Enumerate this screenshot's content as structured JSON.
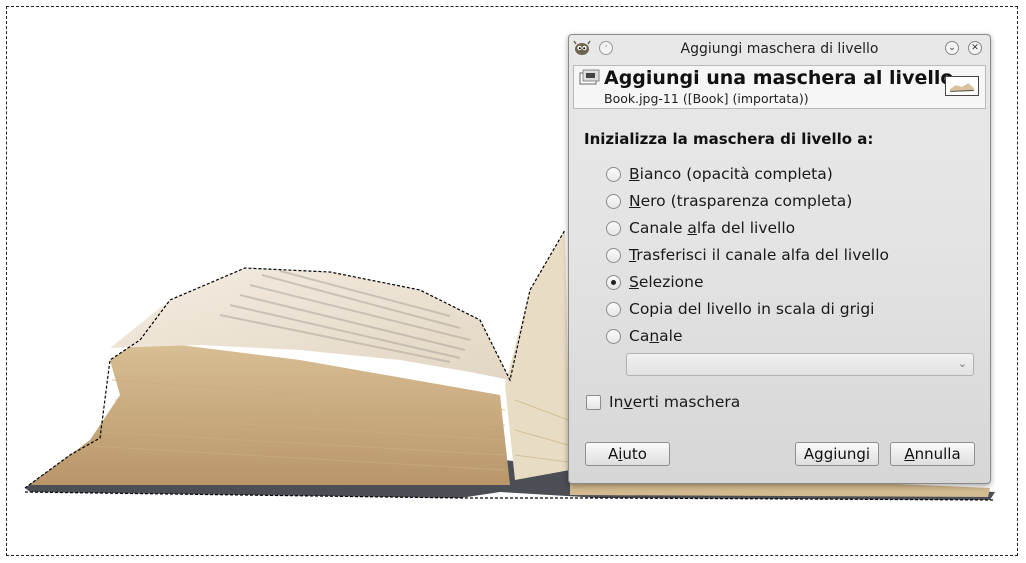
{
  "dialog": {
    "window_title": "Aggiungi maschera di livello",
    "menu_glyph": "·",
    "minimize_glyph": "⌄",
    "close_glyph": "✕",
    "header_title": "Aggiungi una maschera al livello",
    "header_subtitle": "Book.jpg-11 ([Book] (importata))",
    "section_label": "Inizializza la maschera di livello a:",
    "options": [
      {
        "pre": "",
        "u": "B",
        "post": "ianco (opacità completa)",
        "checked": false
      },
      {
        "pre": "",
        "u": "N",
        "post": "ero (trasparenza completa)",
        "checked": false
      },
      {
        "pre": "Canale ",
        "u": "a",
        "post": "lfa del livello",
        "checked": false
      },
      {
        "pre": "",
        "u": "T",
        "post": "rasferisci il canale alfa del livello",
        "checked": false
      },
      {
        "pre": "",
        "u": "S",
        "post": "elezione",
        "checked": true
      },
      {
        "pre": "Copia del livello in scala di ",
        "u": "g",
        "post": "rigi",
        "checked": false
      },
      {
        "pre": "Ca",
        "u": "n",
        "post": "ale",
        "checked": false
      }
    ],
    "channel_combo_value": "",
    "invert": {
      "pre": "In",
      "u": "v",
      "post": "erti maschera",
      "checked": false
    },
    "buttons": {
      "help": {
        "pre": "A",
        "u": "i",
        "post": "uto"
      },
      "add": {
        "pre": "A",
        "u": "g",
        "post": "giungi"
      },
      "cancel": {
        "pre": "",
        "u": "A",
        "post": "nnulla"
      }
    }
  },
  "icons": {
    "wm": "gimp-wilber-icon",
    "header": "layer-mask-icon",
    "thumbnail": "layer-thumbnail",
    "combo": "chevron-down-icon"
  }
}
